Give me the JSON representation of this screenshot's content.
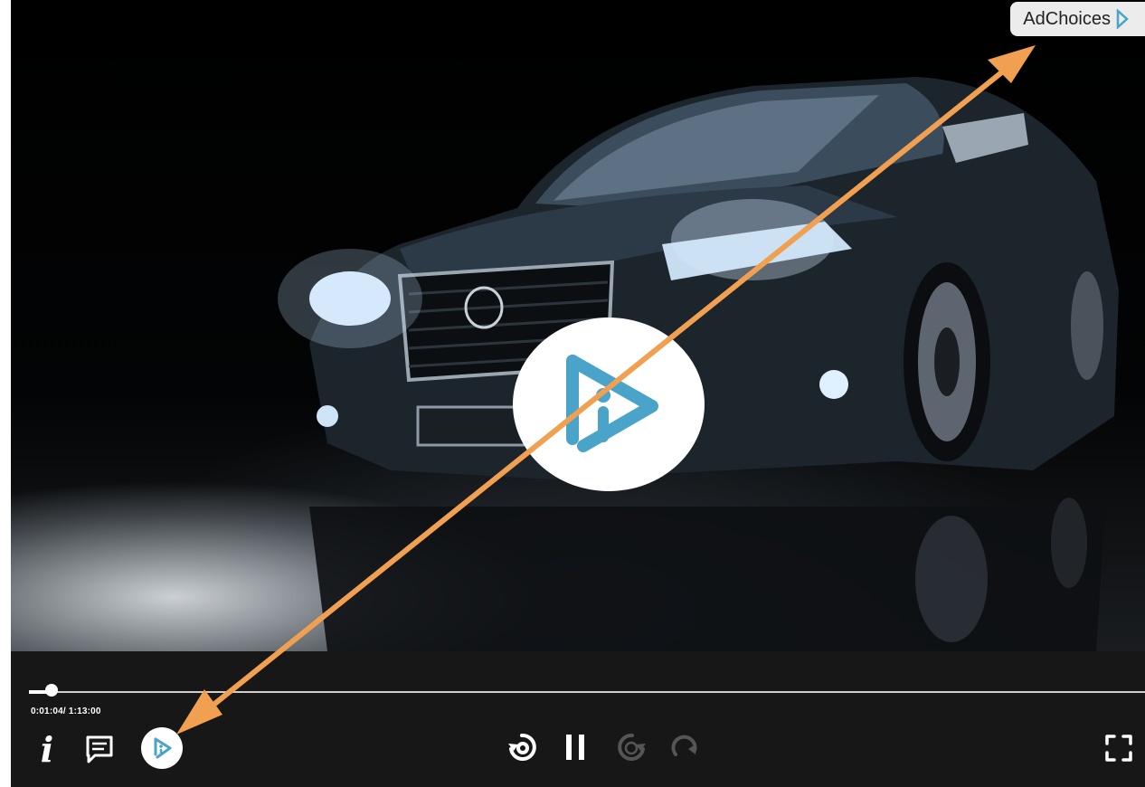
{
  "ad": {
    "label": "AdChoices",
    "icon": "adchoices-icon"
  },
  "player": {
    "center_logo_icon": "brand-play-logo-icon",
    "progress_fraction": 0.02,
    "time_display": "0:01:04/ 1:13:00",
    "controls": {
      "info_label": "i",
      "info_icon": "info-icon",
      "chat_icon": "chat-icon",
      "brand_icon": "brand-play-icon",
      "rewind_icon": "rewind-10-icon",
      "pause_icon": "pause-icon",
      "forward_icon": "forward-10-icon",
      "replay_icon": "replay-icon",
      "fullscreen_icon": "fullscreen-icon"
    }
  },
  "colors": {
    "annotation_arrow": "#f0a050",
    "brand_blue": "#4aa3c8",
    "control_bar": "#171717",
    "adchoices_bg": "#ececec"
  }
}
